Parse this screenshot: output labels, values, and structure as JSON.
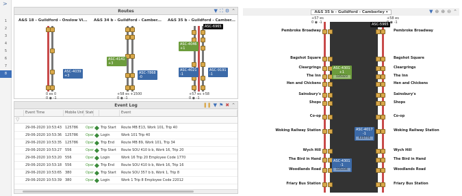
{
  "sidebar": {
    "expand": ">",
    "numbers": [
      "1",
      "2",
      "3",
      "4",
      "5",
      "6",
      "7",
      "8"
    ],
    "active_index": 7
  },
  "routes_panel": {
    "title": "Routes",
    "routes": [
      {
        "title": "A&S 18 - Guildford - Onslow Vi...",
        "bus": {
          "id": "ASC-4039",
          "value": "+3"
        },
        "footer": [
          "0 es  0",
          "0 ◉ -1"
        ]
      },
      {
        "title": "A&S 34 b - Guildford - Camber...",
        "bus_a": {
          "id": "ASC-4141",
          "value": "+3"
        },
        "bus_b": {
          "id": "ASC-7868",
          "value": "-0"
        },
        "footer": [
          "+58 es +1500",
          "0 ◉ -1"
        ]
      },
      {
        "title": "A&S 35 b - Guildford - Camber...",
        "bus_top": {
          "id": "ASC-6965",
          "value": ""
        },
        "bus_a": {
          "id": "ASC-4046",
          "value": "+1"
        },
        "bus_b": {
          "id": "ASC-4021",
          "value": "-1"
        },
        "bus_c": {
          "id": "ASC-9191",
          "value": "-1"
        },
        "footer": [
          "+57 es +58",
          "0 ◉ -1"
        ]
      }
    ]
  },
  "event_log": {
    "title": "Event Log",
    "columns": [
      "",
      "Event Time",
      "Mobile Unit ID",
      "Status",
      "",
      "",
      "Event"
    ],
    "rows": [
      {
        "time": "29-06-2020 10:53:43",
        "unit": "125786",
        "status": "Open",
        "event": "Trip Start",
        "detail": "Route MB E13, Work 101, Trip 40"
      },
      {
        "time": "29-06-2020 10:53:36",
        "unit": "125786",
        "status": "Open",
        "event": "Login",
        "detail": "Work 101 Trip 40"
      },
      {
        "time": "29-06-2020 10:53:35",
        "unit": "125786",
        "status": "Open",
        "event": "Trip End",
        "detail": "Route MB 89, Work 101, Trip 34"
      },
      {
        "time": "29-06-2020 10:53:27",
        "unit": "556",
        "status": "Open",
        "event": "Trip Start",
        "detail": "Route SOU 410 b b, Work 16, Trip 20"
      },
      {
        "time": "29-06-2020 10:53:20",
        "unit": "556",
        "status": "Open",
        "event": "Login",
        "detail": "Work 16 Trip 20 Employee Code 1770"
      },
      {
        "time": "29-06-2020 10:53:18",
        "unit": "556",
        "status": "Open",
        "event": "Trip End",
        "detail": "Route SOU 410 b b, Work 16, Trip 16"
      },
      {
        "time": "29-06-2020 10:53:65",
        "unit": "380",
        "status": "Open",
        "event": "Trip Start",
        "detail": "Route SOU 357 b b, Work 1, Trip 8"
      },
      {
        "time": "29-06-2020 10:53:39",
        "unit": "380",
        "status": "Open",
        "event": "Login",
        "detail": "Work 1 Trip 8 Employee Code 22012"
      }
    ]
  },
  "detail_panel": {
    "title": "A&S 35 b - Guildford - Camberley",
    "top_left": [
      "+57 es",
      "0 ◉ -1"
    ],
    "top_right": [
      "+58 es",
      "0 ◉ -1"
    ],
    "top_bus": "ASC-5965",
    "stops": [
      "Pembroke Broadway",
      "Bagshot Square",
      "Cleargrings",
      "The Inn",
      "Hen and Chickens",
      "Sainsbury's",
      "Shops",
      "Co-op",
      "Woking Railway Station",
      "Wych Hill",
      "The Bird in Hand",
      "Woodlands Road",
      "Friary Bus Station"
    ],
    "buses": [
      {
        "id": "ASC-4301",
        "value": "+1",
        "code": "135323"
      },
      {
        "id": "ASC-4017",
        "value": "-1",
        "code": "435774"
      },
      {
        "id": "ASC-4301",
        "value": "-1",
        "code": "135334"
      }
    ]
  },
  "colors": {
    "accent": "#3d6fb8",
    "bus_blue": "#3c6aa8",
    "bus_green": "#6c9c3c",
    "rail_red": "#c84a4a",
    "stop_gold": "#d9a84a"
  }
}
